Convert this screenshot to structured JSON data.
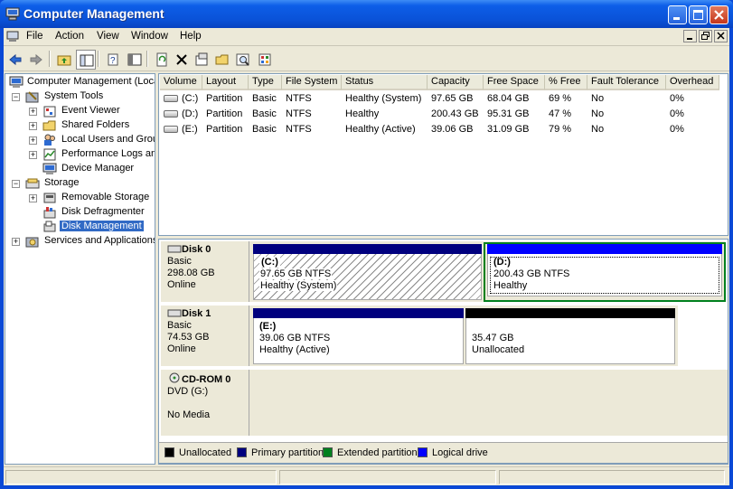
{
  "window": {
    "title": "Computer Management",
    "controls": {
      "minimize": "minimize-icon",
      "maximize": "maximize-icon",
      "close": "close-icon"
    }
  },
  "menubar": {
    "items": [
      "File",
      "Action",
      "View",
      "Window",
      "Help"
    ],
    "mdi_controls": [
      "_",
      "🗗",
      "×"
    ]
  },
  "toolbar": {
    "buttons": [
      "back-icon",
      "forward-icon",
      "up-folder-icon",
      "show-hide-tree-icon",
      "properties-icon",
      "export-list-icon",
      "refresh-icon",
      "delete-icon",
      "properties2-icon",
      "open-icon",
      "search-icon",
      "wizard-icon"
    ]
  },
  "tree": {
    "items": [
      {
        "label": "Computer Management (Local)",
        "level": 0,
        "icon": "computer-icon",
        "expander": ""
      },
      {
        "label": "System Tools",
        "level": 1,
        "icon": "tools-icon",
        "expander": "−"
      },
      {
        "label": "Event Viewer",
        "level": 2,
        "icon": "event-viewer-icon",
        "expander": "+"
      },
      {
        "label": "Shared Folders",
        "level": 2,
        "icon": "shared-folders-icon",
        "expander": "+"
      },
      {
        "label": "Local Users and Groups",
        "level": 2,
        "icon": "users-icon",
        "expander": "+"
      },
      {
        "label": "Performance Logs and Alerts",
        "level": 2,
        "icon": "performance-icon",
        "expander": "+"
      },
      {
        "label": "Device Manager",
        "level": 2,
        "icon": "device-manager-icon",
        "expander": ""
      },
      {
        "label": "Storage",
        "level": 1,
        "icon": "storage-icon",
        "expander": "−"
      },
      {
        "label": "Removable Storage",
        "level": 2,
        "icon": "removable-storage-icon",
        "expander": "+"
      },
      {
        "label": "Disk Defragmenter",
        "level": 2,
        "icon": "defragmenter-icon",
        "expander": ""
      },
      {
        "label": "Disk Management",
        "level": 2,
        "icon": "disk-management-icon",
        "expander": "",
        "selected": true
      },
      {
        "label": "Services and Applications",
        "level": 1,
        "icon": "services-icon",
        "expander": "+"
      }
    ]
  },
  "volumes": {
    "columns": [
      "Volume",
      "Layout",
      "Type",
      "File System",
      "Status",
      "Capacity",
      "Free Space",
      "% Free",
      "Fault Tolerance",
      "Overhead"
    ],
    "rows": [
      [
        "(C:)",
        "Partition",
        "Basic",
        "NTFS",
        "Healthy (System)",
        "97.65 GB",
        "68.04 GB",
        "69 %",
        "No",
        "0%"
      ],
      [
        "(D:)",
        "Partition",
        "Basic",
        "NTFS",
        "Healthy",
        "200.43 GB",
        "95.31 GB",
        "47 %",
        "No",
        "0%"
      ],
      [
        "(E:)",
        "Partition",
        "Basic",
        "NTFS",
        "Healthy (Active)",
        "39.06 GB",
        "31.09 GB",
        "79 %",
        "No",
        "0%"
      ]
    ]
  },
  "disks": [
    {
      "name": "Disk 0",
      "type": "Basic",
      "size": "298.08 GB",
      "status": "Online",
      "partitions": [
        {
          "name": "(C:)",
          "size": "97.65 GB NTFS",
          "status": "Healthy (System)",
          "kind": "primary",
          "hatched": true
        },
        {
          "name": "(D:)",
          "size": "200.43 GB NTFS",
          "status": "Healthy",
          "kind": "primary",
          "selected": true
        }
      ]
    },
    {
      "name": "Disk 1",
      "type": "Basic",
      "size": "74.53 GB",
      "status": "Online",
      "partitions": [
        {
          "name": "(E:)",
          "size": "39.06 GB NTFS",
          "status": "Healthy (Active)",
          "kind": "primary"
        },
        {
          "name": "",
          "size": "35.47 GB",
          "status": "Unallocated",
          "kind": "unallocated"
        }
      ]
    },
    {
      "name": "CD-ROM 0",
      "type": "DVD (G:)",
      "size": "",
      "status": "No Media",
      "partitions": []
    }
  ],
  "legend": [
    {
      "label": "Unallocated",
      "color": "#000000"
    },
    {
      "label": "Primary partition",
      "color": "#00007e"
    },
    {
      "label": "Extended partition",
      "color": "#00801e"
    },
    {
      "label": "Logical drive",
      "color": "#0000ff"
    }
  ]
}
